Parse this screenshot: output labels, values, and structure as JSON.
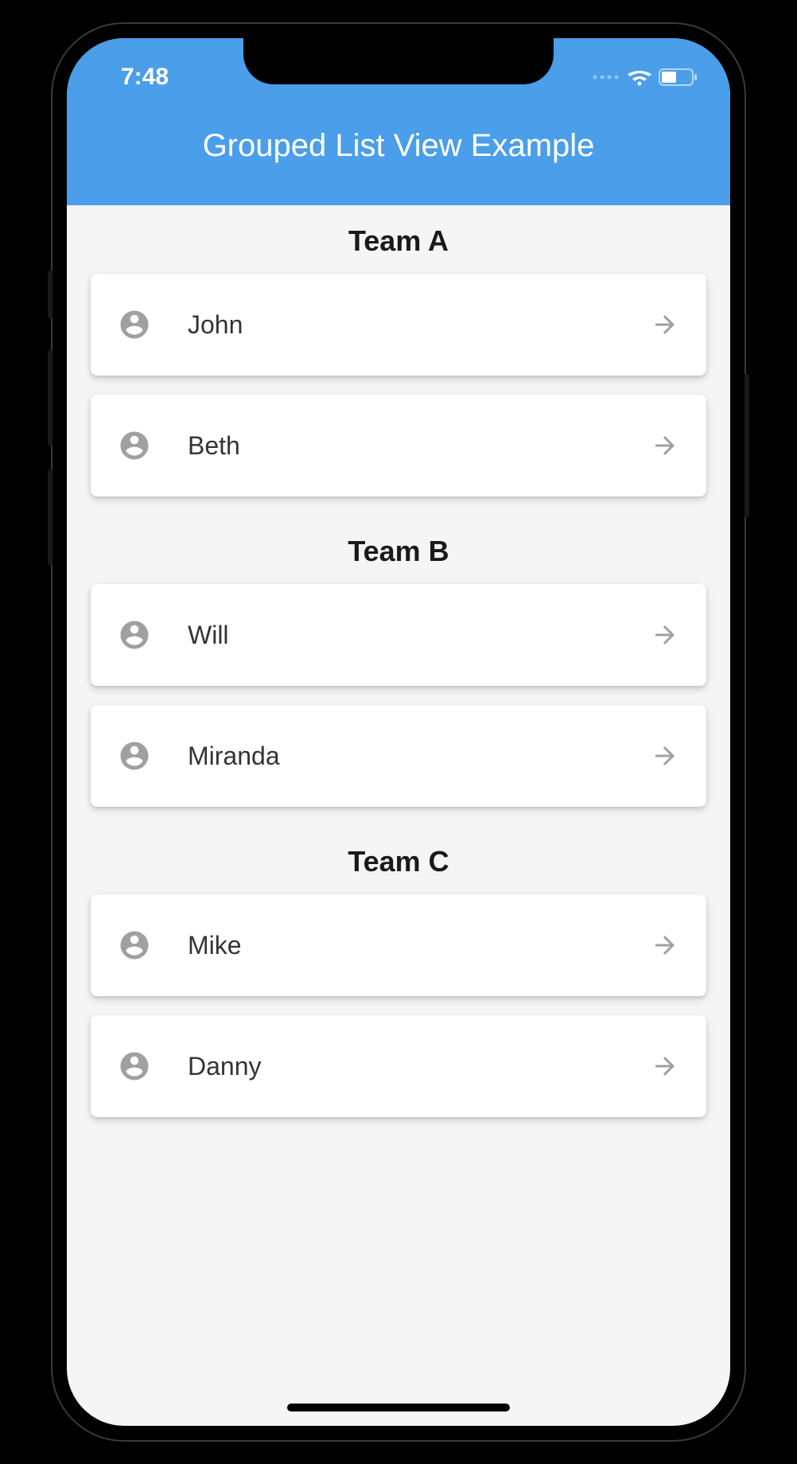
{
  "status_bar": {
    "time": "7:48"
  },
  "app_bar": {
    "title": "Grouped List View Example"
  },
  "groups": [
    {
      "header": "Team A",
      "members": [
        {
          "name": "John"
        },
        {
          "name": "Beth"
        }
      ]
    },
    {
      "header": "Team B",
      "members": [
        {
          "name": "Will"
        },
        {
          "name": "Miranda"
        }
      ]
    },
    {
      "header": "Team C",
      "members": [
        {
          "name": "Mike"
        },
        {
          "name": "Danny"
        }
      ]
    }
  ]
}
